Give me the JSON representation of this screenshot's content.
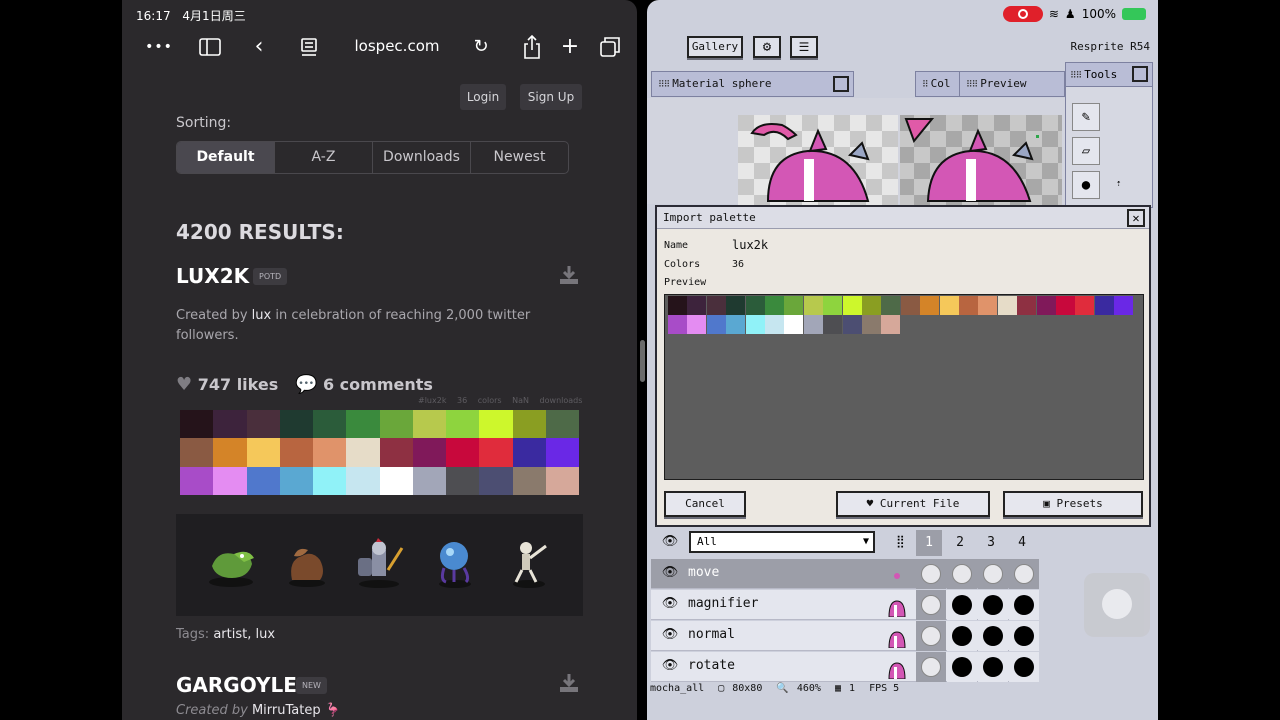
{
  "ipad_status": {
    "time": "16:17",
    "date": "4月1日周三",
    "battery": "100%"
  },
  "safari": {
    "url": "lospec.com",
    "login_label": "Login",
    "signup_label": "Sign Up"
  },
  "lospec": {
    "sorting_label": "Sorting:",
    "sort_options": [
      "Default",
      "A-Z",
      "Downloads",
      "Newest"
    ],
    "results": "4200 RESULTS:",
    "palette1": {
      "title": "LUX2K",
      "badge": "POTD",
      "desc_prefix": "Created by",
      "author": "lux",
      "desc_suffix": "in celebration of reaching 2,000 twitter followers.",
      "likes": "747 likes",
      "comments": "6 comments",
      "tag_slug": "#lux2k",
      "tag_colors": "36 colors",
      "tag_downloads": "NaN downloads",
      "tags_label": "Tags:",
      "tags": "artist, lux",
      "colors": [
        "#25131a",
        "#3d233c",
        "#4a2f3c",
        "#1f3a30",
        "#2b5c3a",
        "#3a8a3d",
        "#6aa73a",
        "#b7c94d",
        "#8ed43e",
        "#cdf72c",
        "#8a9e22",
        "#4e6a48",
        "#8a5a43",
        "#d48428",
        "#f5c85a",
        "#b86540",
        "#e0936a",
        "#e6dcc8",
        "#8e3042",
        "#80195a",
        "#c8083c",
        "#e02c3c",
        "#3a2aa0",
        "#6a28e6",
        "#a84cc8",
        "#e48cf2",
        "#5078cc",
        "#5aa8d2",
        "#90f2f8",
        "#c6e6f0",
        "#ffffff",
        "#a2a6b8",
        "#4e4e52",
        "#4c4e72",
        "#8a7a6c",
        "#d6a89a"
      ]
    },
    "palette2": {
      "title": "GARGOYLE",
      "badge": "NEW",
      "desc_prefix": "Created by",
      "author": "MirruTatep"
    }
  },
  "resprite": {
    "app_name": "Resprite R54",
    "gallery_label": "Gallery",
    "panel_material": "Material sphere",
    "panel_colors": "Col",
    "panel_preview": "Preview",
    "panel_tools": "Tools",
    "dialog": {
      "title": "Import palette",
      "name_label": "Name",
      "name_value": "lux2k",
      "colors_label": "Colors",
      "colors_value": "36",
      "preview_label": "Preview",
      "cancel_label": "Cancel",
      "current_file_label": "Current File",
      "presets_label": "Presets"
    },
    "filter_value": "All",
    "frames": [
      "1",
      "2",
      "3",
      "4"
    ],
    "layers": [
      {
        "name": "move"
      },
      {
        "name": "magnifier"
      },
      {
        "name": "normal"
      },
      {
        "name": "rotate"
      }
    ],
    "statusbar": {
      "file": "mocha_all",
      "size": "80x80",
      "zoom": "460%",
      "frame": "1",
      "fps": "FPS 5"
    }
  }
}
